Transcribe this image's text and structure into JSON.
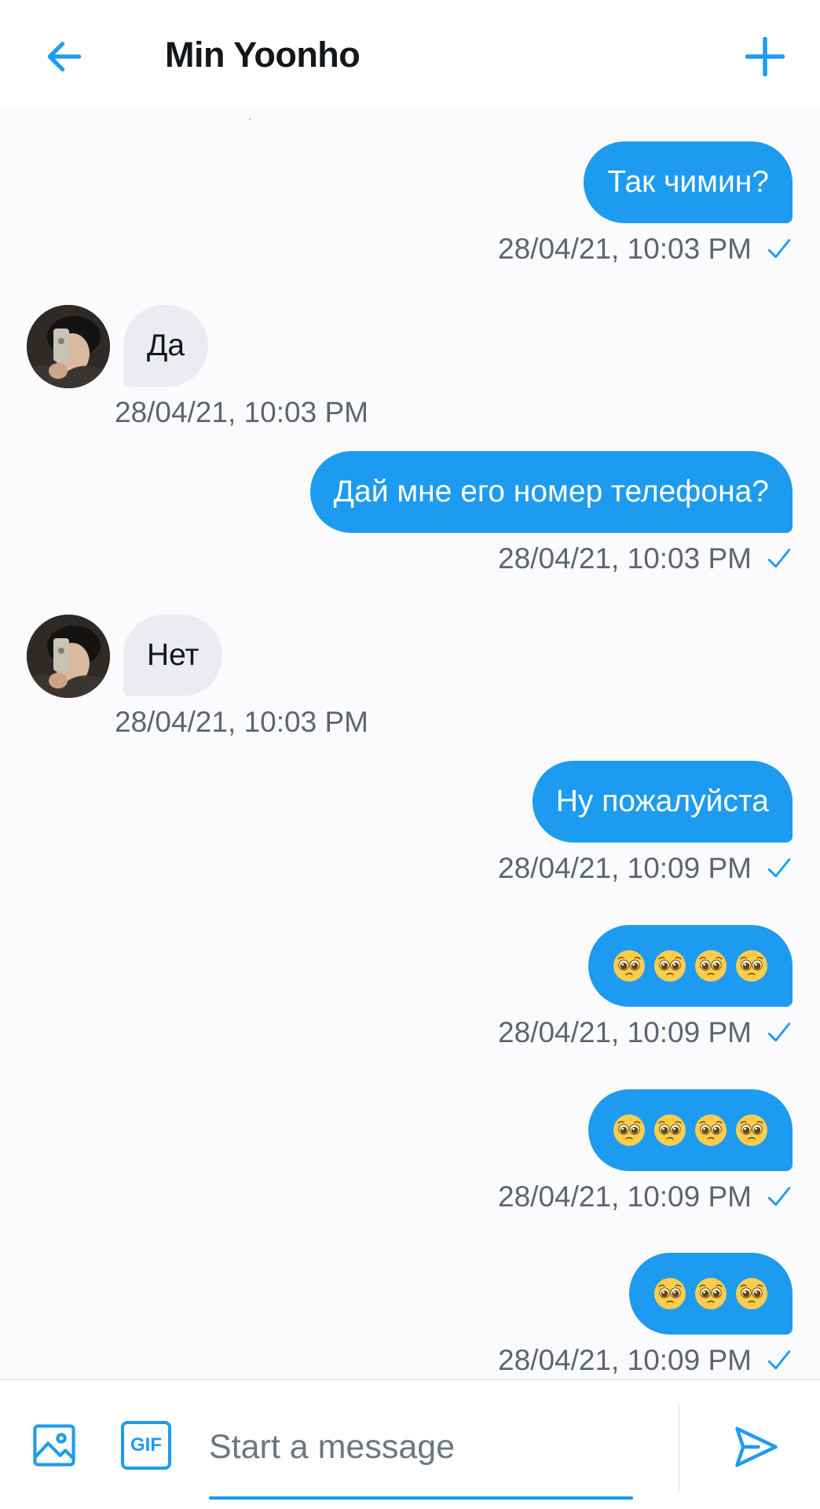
{
  "header": {
    "title": "Min Yoonho",
    "back_icon": "arrow-left-icon",
    "add_icon": "plus-icon"
  },
  "colors": {
    "accent": "#1d9bf0",
    "received_bubble": "#eaecf2",
    "timestamp": "#5b6670"
  },
  "messages": [
    {
      "direction": "sent",
      "text": "Так чимин?",
      "time": "28/04/21, 10:03 PM"
    },
    {
      "direction": "received",
      "text": "Да",
      "time": "28/04/21, 10:03 PM"
    },
    {
      "direction": "sent",
      "text": "Дай мне его номер телефона?",
      "time": "28/04/21, 10:03 PM"
    },
    {
      "direction": "received",
      "text": "Нет",
      "time": "28/04/21, 10:03 PM"
    },
    {
      "direction": "sent",
      "text": "Ну пожалуйста",
      "time": "28/04/21, 10:09 PM"
    },
    {
      "direction": "sent",
      "text": "🥺🥺🥺🥺",
      "emoji": "pleading-face",
      "emoji_count": 4,
      "time": "28/04/21, 10:09 PM"
    },
    {
      "direction": "sent",
      "text": "🥺🥺🥺🥺",
      "emoji": "pleading-face",
      "emoji_count": 4,
      "time": "28/04/21, 10:09 PM"
    },
    {
      "direction": "sent",
      "text": "🥺🥺🥺",
      "emoji": "pleading-face",
      "emoji_count": 3,
      "time": "28/04/21, 10:09 PM"
    }
  ],
  "composer": {
    "placeholder": "Start a message",
    "gif_label": "GIF",
    "media_icon": "image-icon",
    "send_icon": "send-icon"
  }
}
